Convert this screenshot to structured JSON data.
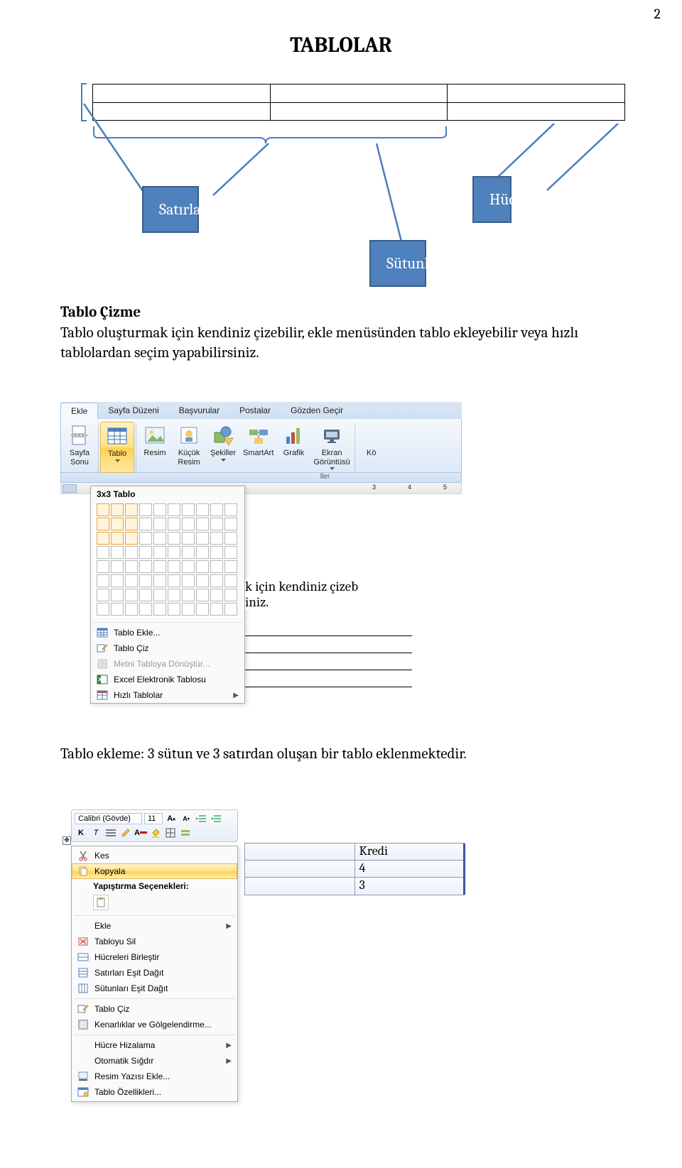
{
  "page_number": "2",
  "title": "TABLOLAR",
  "diagram": {
    "satirlar_label": "Satırlar",
    "hucre_label": "Hücre",
    "sutunlar_label": "Sütunlar"
  },
  "section1_heading": "Tablo Çizme",
  "section1_body": "Tablo oluşturmak için kendiniz çizebilir, ekle menüsünden tablo ekleyebilir veya hızlı tablolardan seçim yapabilirsiniz.",
  "ribbon": {
    "tabs": [
      "Ekle",
      "Sayfa Düzeni",
      "Başvurular",
      "Postalar",
      "Gözden Geçir"
    ],
    "buttons": {
      "sayfa_sonu": "Sayfa\nSonu",
      "tablo": "Tablo",
      "resim": "Resim",
      "kucuk_resim": "Küçük\nResim",
      "sekiller": "Şekiller",
      "smartart": "SmartArt",
      "grafik": "Grafik",
      "ekran_goruntusu": "Ekran\nGörüntüsü",
      "ko": "Kö"
    },
    "group_label": "ller",
    "ruler_marks": [
      "3",
      "4",
      "5"
    ]
  },
  "table_menu": {
    "title": "3x3 Tablo",
    "selected_rows": 3,
    "selected_cols": 3,
    "items": {
      "tablo_ekle": "Tablo Ekle...",
      "tablo_ciz": "Tablo Çiz",
      "metni_donustur": "Metni Tabloya Dönüştür...",
      "excel": "Excel Elektronik Tablosu",
      "hizli": "Hızlı Tablolar"
    }
  },
  "doc_fragment": {
    "line1": "k için kendiniz çizeb",
    "line2": "iniz."
  },
  "section2_body": "Tablo ekleme: 3 sütun ve 3 satırdan oluşan bir tablo eklenmektedir.",
  "mini_toolbar": {
    "font_name": "Calibri (Gövde)",
    "font_size": "11"
  },
  "context_menu": {
    "kes": "Kes",
    "kopyala": "Kopyala",
    "yapistirma": "Yapıştırma Seçenekleri:",
    "ekle": "Ekle",
    "tabloyu_sil": "Tabloyu Sil",
    "hucreleri_birlestir": "Hücreleri Birleştir",
    "satirlari_esit": "Satırları Eşit Dağıt",
    "sutunlari_esit": "Sütunları Eşit Dağıt",
    "tablo_ciz": "Tablo Çiz",
    "kenarliklar": "Kenarlıklar ve Gölgelendirme...",
    "hucre_hizalama": "Hücre Hizalama",
    "otomatik_sigdir": "Otomatik Sığdır",
    "resim_yazisi": "Resim Yazısı Ekle...",
    "tablo_ozellikleri": "Tablo Özellikleri..."
  },
  "kredi_table": {
    "rows": [
      [
        "",
        "Kredi"
      ],
      [
        "",
        "4"
      ],
      [
        "",
        "3"
      ]
    ]
  }
}
